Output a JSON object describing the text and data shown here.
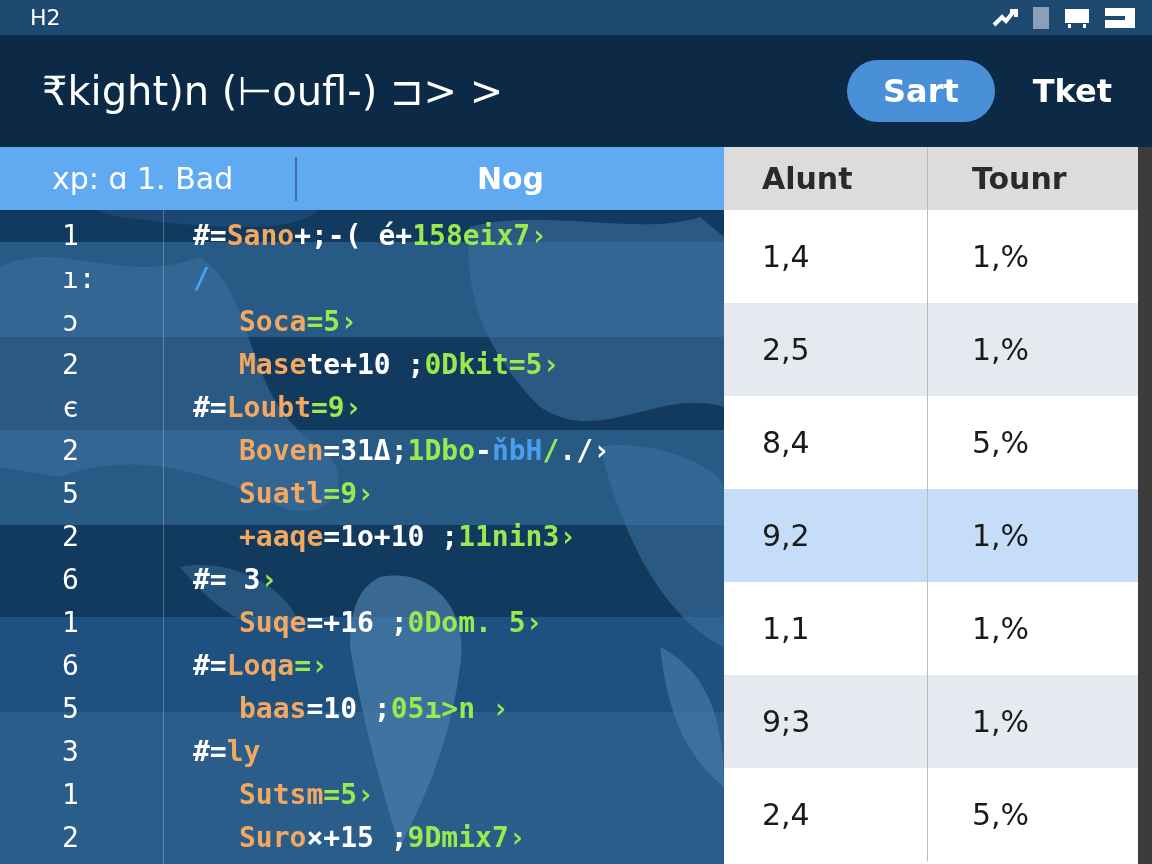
{
  "top_bar": {
    "title": "H2"
  },
  "header": {
    "title": "₹kight)n (⊢oufl-) ⊐> >",
    "buttons": [
      {
        "label": "Sart",
        "kind": "primary"
      },
      {
        "label": "Tket",
        "kind": "text"
      }
    ]
  },
  "table": {
    "columns": [
      "xp: ɑ 1. Bad",
      "Nog",
      "Alunt",
      "Tounr"
    ],
    "rows": [
      {
        "amount": "1,4",
        "share": "1,%",
        "selected": false
      },
      {
        "amount": "2,5",
        "share": "1,%",
        "selected": false
      },
      {
        "amount": "8,4",
        "share": "5,%",
        "selected": false
      },
      {
        "amount": "9,2",
        "share": "1,%",
        "selected": true
      },
      {
        "amount": "1,1",
        "share": "1,%",
        "selected": false
      },
      {
        "amount": "9;3",
        "share": "1,%",
        "selected": false
      },
      {
        "amount": "2,4",
        "share": "5,%",
        "selected": false
      }
    ]
  },
  "code_lines": [
    {
      "number": "1",
      "indent": false,
      "parts": [
        {
          "kind": "plain",
          "text": "#="
        },
        {
          "kind": "key",
          "text": "Sano"
        },
        {
          "kind": "plain",
          "text": "+;-( é+"
        },
        {
          "kind": "value",
          "text": "158eix7›"
        }
      ]
    },
    {
      "number": "ı:",
      "indent": false,
      "parts": [
        {
          "kind": "link",
          "text": "/"
        }
      ]
    },
    {
      "number": "ɔ",
      "indent": true,
      "parts": [
        {
          "kind": "key",
          "text": "Soca"
        },
        {
          "kind": "value",
          "text": "=5›"
        }
      ]
    },
    {
      "number": "2",
      "indent": true,
      "parts": [
        {
          "kind": "key",
          "text": "Mase"
        },
        {
          "kind": "plain",
          "text": "te+10 ;"
        },
        {
          "kind": "value",
          "text": "0Dkit=5›"
        }
      ]
    },
    {
      "number": "є",
      "indent": false,
      "parts": [
        {
          "kind": "plain",
          "text": "#="
        },
        {
          "kind": "key",
          "text": "Loubt"
        },
        {
          "kind": "value",
          "text": "=9›"
        }
      ]
    },
    {
      "number": "2",
      "indent": true,
      "parts": [
        {
          "kind": "key",
          "text": "Boven"
        },
        {
          "kind": "plain",
          "text": "=31Δ;"
        },
        {
          "kind": "value",
          "text": "1Dbo"
        },
        {
          "kind": "plain",
          "text": "-"
        },
        {
          "kind": "link",
          "text": "ňbH"
        },
        {
          "kind": "value",
          "text": "/"
        },
        {
          "kind": "plain",
          "text": "./›"
        }
      ]
    },
    {
      "number": "5",
      "indent": true,
      "parts": [
        {
          "kind": "key",
          "text": "Suatl"
        },
        {
          "kind": "value",
          "text": "=9›"
        }
      ]
    },
    {
      "number": "2",
      "indent": true,
      "parts": [
        {
          "kind": "key",
          "text": "+aaqe"
        },
        {
          "kind": "plain",
          "text": "=1o+10 ;"
        },
        {
          "kind": "value",
          "text": "11nin3›"
        }
      ]
    },
    {
      "number": "6",
      "indent": false,
      "parts": [
        {
          "kind": "plain",
          "text": "#= 3"
        },
        {
          "kind": "value",
          "text": "›"
        }
      ]
    },
    {
      "number": "1",
      "indent": true,
      "parts": [
        {
          "kind": "key",
          "text": "Suqe"
        },
        {
          "kind": "plain",
          "text": "=+16 ;"
        },
        {
          "kind": "value",
          "text": "0Dom. 5›"
        }
      ]
    },
    {
      "number": "6",
      "indent": false,
      "parts": [
        {
          "kind": "plain",
          "text": "#="
        },
        {
          "kind": "key",
          "text": "Loqa"
        },
        {
          "kind": "value",
          "text": "=›"
        }
      ]
    },
    {
      "number": "5",
      "indent": true,
      "parts": [
        {
          "kind": "key",
          "text": "baas"
        },
        {
          "kind": "plain",
          "text": "=10 ;"
        },
        {
          "kind": "value",
          "text": "05ı>n ›"
        }
      ]
    },
    {
      "number": "3",
      "indent": false,
      "parts": [
        {
          "kind": "plain",
          "text": "#="
        },
        {
          "kind": "key",
          "text": "ly"
        }
      ]
    },
    {
      "number": "1",
      "indent": true,
      "parts": [
        {
          "kind": "key",
          "text": "Sutsm"
        },
        {
          "kind": "value",
          "text": "=5›"
        }
      ]
    },
    {
      "number": "2",
      "indent": true,
      "parts": [
        {
          "kind": "key",
          "text": "Suro"
        },
        {
          "kind": "plain",
          "text": "×+15 ;"
        },
        {
          "kind": "value",
          "text": "9Dmix7›"
        }
      ]
    }
  ]
}
